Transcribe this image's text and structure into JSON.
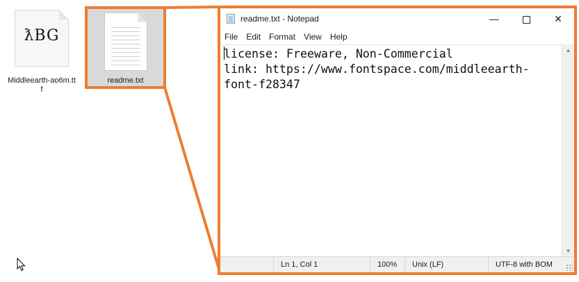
{
  "desktop": {
    "font_file": {
      "label": "Middleearth-ao6m.ttf",
      "preview_glyphs": "ƛBG"
    },
    "readme_file": {
      "label": "readme.txt"
    }
  },
  "notepad": {
    "title": "readme.txt - Notepad",
    "window_controls": {
      "minimize": "—",
      "maximize": "",
      "close": "✕"
    },
    "menu": [
      "File",
      "Edit",
      "Format",
      "View",
      "Help"
    ],
    "content_lines": [
      "license: Freeware, Non-Commercial",
      "link: https://www.fontspace.com/middleearth-",
      "font-f28347"
    ],
    "status": {
      "position": "Ln 1, Col 1",
      "zoom": "100%",
      "line_ending": "Unix (LF)",
      "encoding": "UTF-8 with BOM"
    }
  },
  "colors": {
    "highlight": "#ed7d31",
    "selection": "#d9d9d9"
  },
  "icons": {
    "font_file": "font-file-icon",
    "text_file": "text-file-icon",
    "app": "notepad-icon",
    "cursor": "mouse-pointer-icon"
  }
}
